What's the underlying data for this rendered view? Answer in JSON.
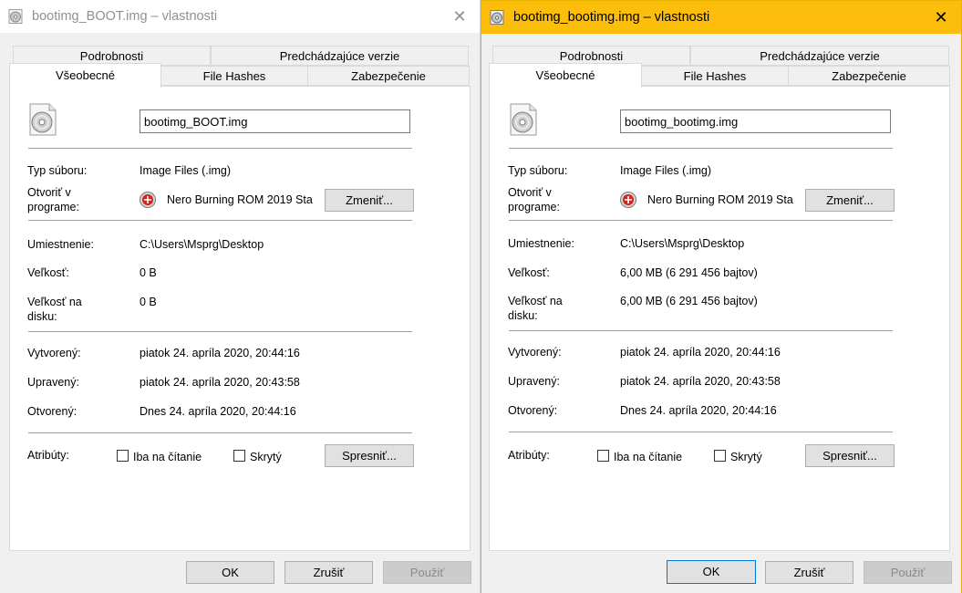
{
  "left": {
    "title": "bootimg_BOOT.img – vlastnosti",
    "close": "✕",
    "tabs": {
      "details": "Podrobnosti",
      "previous": "Predchádzajúce verzie",
      "general": "Všeobecné",
      "hashes": "File Hashes",
      "security": "Zabezpečenie"
    },
    "filename": "bootimg_BOOT.img",
    "type_label": "Typ súboru:",
    "type_value": "Image Files (.img)",
    "openwith_label": "Otvoriť v programe:",
    "openwith_value": "Nero Burning ROM 2019 Sta",
    "change_button": "Zmeniť...",
    "location_label": "Umiestnenie:",
    "location_value": "C:\\Users\\Msprg\\Desktop",
    "size_label": "Veľkosť:",
    "size_value": "0 B",
    "disksize_label": "Veľkosť na disku:",
    "disksize_value": "0 B",
    "created_label": "Vytvorený:",
    "created_value": "piatok 24. apríla 2020, 20:44:16",
    "modified_label": "Upravený:",
    "modified_value": "piatok 24. apríla 2020, 20:43:58",
    "accessed_label": "Otvorený:",
    "accessed_value": "Dnes 24. apríla 2020, 20:44:16",
    "attributes_label": "Atribúty:",
    "readonly_label": "Iba na čítanie",
    "hidden_label": "Skrytý",
    "advanced_button": "Spresniť...",
    "ok": "OK",
    "cancel": "Zrušiť",
    "apply": "Použiť"
  },
  "right": {
    "title": "bootimg_bootimg.img – vlastnosti",
    "close": "✕",
    "tabs": {
      "details": "Podrobnosti",
      "previous": "Predchádzajúce verzie",
      "general": "Všeobecné",
      "hashes": "File Hashes",
      "security": "Zabezpečenie"
    },
    "filename": "bootimg_bootimg.img",
    "type_label": "Typ súboru:",
    "type_value": "Image Files (.img)",
    "openwith_label": "Otvoriť v programe:",
    "openwith_value": "Nero Burning ROM 2019 Sta",
    "change_button": "Zmeniť...",
    "location_label": "Umiestnenie:",
    "location_value": "C:\\Users\\Msprg\\Desktop",
    "size_label": "Veľkosť:",
    "size_value": "6,00 MB (6 291 456 bajtov)",
    "disksize_label": "Veľkosť na disku:",
    "disksize_value": "6,00 MB (6 291 456 bajtov)",
    "created_label": "Vytvorený:",
    "created_value": "piatok 24. apríla 2020, 20:44:16",
    "modified_label": "Upravený:",
    "modified_value": "piatok 24. apríla 2020, 20:43:58",
    "accessed_label": "Otvorený:",
    "accessed_value": "Dnes 24. apríla 2020, 20:44:16",
    "attributes_label": "Atribúty:",
    "readonly_label": "Iba na čítanie",
    "hidden_label": "Skrytý",
    "advanced_button": "Spresniť...",
    "ok": "OK",
    "cancel": "Zrušiť",
    "apply": "Použiť"
  },
  "colors": {
    "active_titlebar": "#fcbe0a",
    "focus_border": "#0078d7"
  },
  "icons": {
    "file": "disc-image-icon",
    "program": "nero-icon",
    "close": "close-icon"
  }
}
